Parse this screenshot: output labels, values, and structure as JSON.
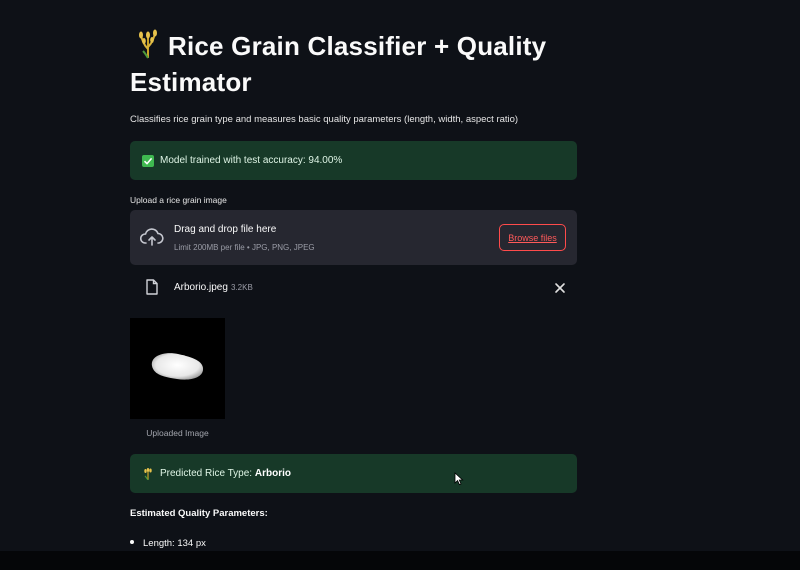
{
  "header": {
    "title": "Rice Grain Classifier + Quality Estimator",
    "title_icon": "rice-sheaf-icon",
    "subtitle": "Classifies rice grain type and measures basic quality parameters (length, width, aspect ratio)"
  },
  "status": {
    "accuracy_text": "Model trained with test accuracy: 94.00%",
    "accuracy_icon": "check-box-icon"
  },
  "uploader": {
    "label": "Upload a rice grain image",
    "drop_title": "Drag and drop file here",
    "limit_text": "Limit 200MB per file • JPG, PNG, JPEG",
    "browse_label": "Browse files",
    "upload_icon": "cloud-upload-icon"
  },
  "uploaded_file": {
    "name": "Arborio.jpeg",
    "size": "3.2KB",
    "file_icon": "document-icon",
    "remove_icon": "close-icon"
  },
  "preview": {
    "caption": "Uploaded Image"
  },
  "prediction": {
    "prefix": "Predicted Rice Type:",
    "value": "Arborio",
    "icon": "rice-sheaf-icon"
  },
  "quality": {
    "heading": "Estimated Quality Parameters:",
    "items": [
      {
        "label": "Length:",
        "value": "134 px"
      }
    ]
  },
  "colors": {
    "background": "#0e1117",
    "success_bg": "#173928",
    "uploader_bg": "#262730",
    "accent": "#ff4b4b"
  }
}
